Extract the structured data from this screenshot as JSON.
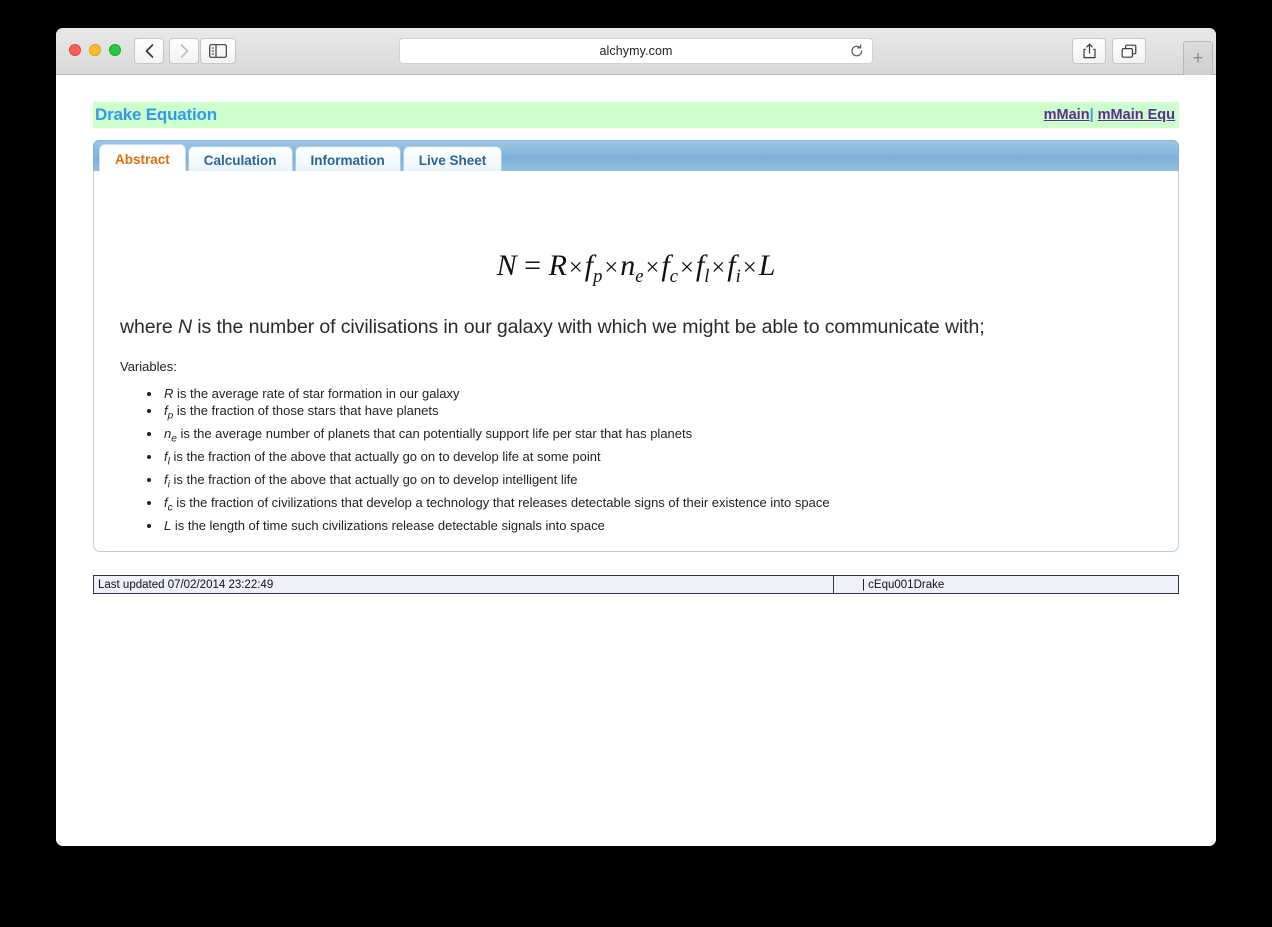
{
  "browser": {
    "url": "alchymy.com",
    "back_icon": "chevron-left-icon",
    "forward_icon": "chevron-right-icon",
    "sidebar_icon": "sidebar-toggle-icon",
    "reload_icon": "reload-icon",
    "share_icon": "share-icon",
    "tabs_icon": "show-tabs-icon",
    "new_tab_label": "+"
  },
  "header": {
    "title": "Drake Equation",
    "links": [
      {
        "label": "mMain"
      },
      {
        "label": "mMain Equ"
      }
    ],
    "separator": "|",
    "bar_color": "#ccffcc",
    "title_color": "#3399ee",
    "link_color": "#5c2d91"
  },
  "tabs": [
    {
      "label": "Abstract",
      "active": true
    },
    {
      "label": "Calculation",
      "active": false
    },
    {
      "label": "Information",
      "active": false
    },
    {
      "label": "Live Sheet",
      "active": false
    }
  ],
  "tab_colors": {
    "active_text": "#e06f10",
    "inactive_text": "#2a6496",
    "strip": "#82b4db"
  },
  "content": {
    "equation": {
      "lhs": "N",
      "equals": "=",
      "factors": [
        {
          "base": "R",
          "sub": ""
        },
        {
          "base": "f",
          "sub": "p"
        },
        {
          "base": "n",
          "sub": "e"
        },
        {
          "base": "f",
          "sub": "c"
        },
        {
          "base": "f",
          "sub": "l"
        },
        {
          "base": "f",
          "sub": "i"
        },
        {
          "base": "L",
          "sub": ""
        }
      ],
      "operator": "×",
      "plain": "N = R × f_p × n_e × f_c × f_l × f_i × L"
    },
    "where_prefix": "where ",
    "where_symbol": "N",
    "where_suffix": " is the number of civilisations in our galaxy with which we might be able to communicate with;",
    "variables_label": "Variables:",
    "variables": [
      {
        "symbol": "R",
        "sub": "",
        "text": " is the average rate of star formation in our galaxy"
      },
      {
        "symbol": "f",
        "sub": "p",
        "text": " is the fraction of those stars that have planets"
      },
      {
        "symbol": "n",
        "sub": "e",
        "text": " is the average number of planets that can potentially support life per star that has planets"
      },
      {
        "symbol": "f",
        "sub": "l",
        "text": " is the fraction of the above that actually go on to develop life at some point"
      },
      {
        "symbol": "f",
        "sub": "i",
        "text": " is the fraction of the above that actually go on to develop intelligent life"
      },
      {
        "symbol": "f",
        "sub": "c",
        "text": " is the fraction of civilizations that develop a technology that releases detectable signs of their existence into space"
      },
      {
        "symbol": "L",
        "sub": "",
        "text": " is the length of time such civilizations release detectable signals into space"
      }
    ]
  },
  "footer": {
    "last_updated": "Last updated 07/02/2014 23:22:49",
    "page_code": "| cEqu001Drake"
  }
}
